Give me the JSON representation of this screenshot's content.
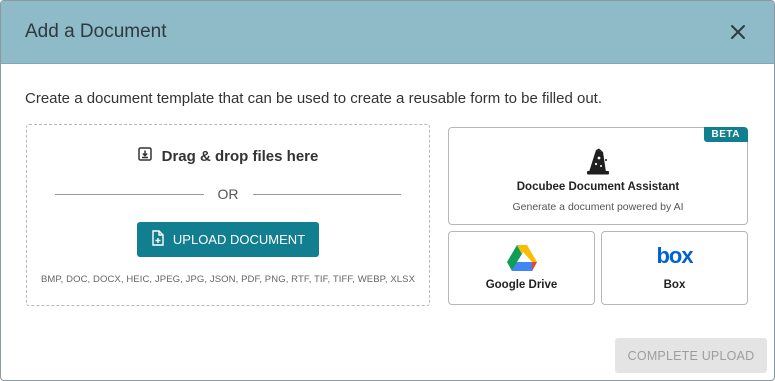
{
  "dialog": {
    "title": "Add a Document",
    "close_icon": "close-icon"
  },
  "description": "Create a document template that can be used to create a reusable form to be filled out.",
  "dropzone": {
    "title": "Drag & drop files here",
    "title_icon": "download-icon",
    "or_text": "OR",
    "upload_label": "UPLOAD DOCUMENT",
    "upload_icon": "file-add-icon",
    "formats": "BMP, DOC, DOCX, HEIC, JPEG, JPG, JSON, PDF, PNG, RTF, TIF, TIFF, WEBP, XLSX"
  },
  "sources": {
    "assistant": {
      "badge": "BETA",
      "name": "Docubee Document Assistant",
      "subtitle": "Generate a document powered by AI",
      "icon": "wizard-hat-icon"
    },
    "google_drive": {
      "name": "Google Drive",
      "icon": "google-drive-icon"
    },
    "box": {
      "name": "Box",
      "logo_text": "box",
      "icon": "box-logo-icon"
    }
  },
  "footer": {
    "complete_label": "COMPLETE UPLOAD"
  },
  "colors": {
    "header_bg": "#8fbac7",
    "accent": "#127f90",
    "box_blue": "#0061d5",
    "disabled_bg": "#e4e4e4"
  }
}
